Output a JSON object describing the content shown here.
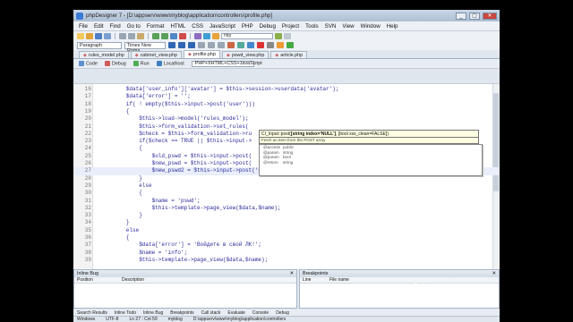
{
  "window": {
    "title": "phpDesigner 7 - [D:\\appserv\\www\\myblog\\application\\controllers\\profile.php]"
  },
  "menu": [
    "File",
    "Edit",
    "Find",
    "Go to",
    "Format",
    "HTML",
    "CSS",
    "JavaScript",
    "PHP",
    "Debug",
    "Project",
    "Tools",
    "SVN",
    "View",
    "Window",
    "Help"
  ],
  "toolbar": {
    "address": "http"
  },
  "format": {
    "style": "Paragraph",
    "font": "Times New Roma"
  },
  "file_tabs": [
    {
      "label": "rules_model.php",
      "active": false
    },
    {
      "label": "cabinet_view.php",
      "active": false
    },
    {
      "label": "profile.php",
      "active": true
    },
    {
      "label": "pswd_view.php",
      "active": false
    },
    {
      "label": "article.php",
      "active": false
    }
  ],
  "subbar": {
    "code": "Code",
    "debug": "Debug",
    "run": "Run",
    "server": "Localhost",
    "doctype": "PHP+XHTML+CSS+JavaScript"
  },
  "code_lines": [
    {
      "n": "16",
      "text": "        $data['user_info']['avatar'] = $this->session->userdata('avatar');"
    },
    {
      "n": "17",
      "text": "        $data['error'] = '';"
    },
    {
      "n": "18",
      "text": "        if( ! empty($this->input->post('user')))"
    },
    {
      "n": "19",
      "text": "        {"
    },
    {
      "n": "20",
      "text": "            $this->load->model('rules_model');"
    },
    {
      "n": "21",
      "text": "            $this->form_validation->set_rules("
    },
    {
      "n": "22",
      "text": "            $check = $this->form_validation->ru"
    },
    {
      "n": "23",
      "text": "            if($check == TRUE || $this->input->"
    },
    {
      "n": "24",
      "text": "            {"
    },
    {
      "n": "25",
      "text": "                $old_pswd = $this->input->post("
    },
    {
      "n": "26",
      "text": "                $new_pswd = $this->input->post("
    },
    {
      "n": "27",
      "text": "                $new_pswd2 = $this->input->post('new_pswd2');"
    },
    {
      "n": "28",
      "text": "            }"
    },
    {
      "n": "29",
      "text": "            else"
    },
    {
      "n": "30",
      "text": "            {"
    },
    {
      "n": "31",
      "text": "                $name = 'pswd';"
    },
    {
      "n": "32",
      "text": "                $this->template->page_view($data,$name);"
    },
    {
      "n": "33",
      "text": "            }"
    },
    {
      "n": "34",
      "text": "        }"
    },
    {
      "n": "35",
      "text": "        else"
    },
    {
      "n": "36",
      "text": "        {"
    },
    {
      "n": "37",
      "text": "            $data['error'] = 'Войдите в свой ЛК!';"
    },
    {
      "n": "38",
      "text": "            $name = 'info';"
    },
    {
      "n": "39",
      "text": "            $this->template->page_view($data,$name);"
    }
  ],
  "tooltip": {
    "prefix": "CI_Input::post(",
    "bold": "[string index='NULL']",
    "suffix": ", [bool xss_clean=FALSE])",
    "desc": "Fetch an item from the POST array"
  },
  "autocomplete": [
    {
      "k": "@access",
      "v": "public"
    },
    {
      "k": "@param",
      "v": "string"
    },
    {
      "k": "@param",
      "v": "bool"
    },
    {
      "k": "@return",
      "v": "string"
    }
  ],
  "panels": {
    "left": {
      "title": "Inline Bug",
      "cols": [
        "Position",
        "Description"
      ]
    },
    "right": {
      "title": "Breakpoints",
      "cols": [
        "Line",
        "File name"
      ]
    }
  },
  "bottom_tabs": [
    "Search Results",
    "Inline Todo",
    "Inline Bug",
    "Breakpoints",
    "Call stack",
    "Evaluate",
    "Console",
    "Debug"
  ],
  "status": {
    "os": "Windows",
    "enc": "UTF-8",
    "pos": "Ln 27 : Col 59",
    "project": "myblog",
    "path": "D:\\appserv\\www\\myblog\\application\\controllers"
  },
  "watermark": "www.fak.ax3.net"
}
